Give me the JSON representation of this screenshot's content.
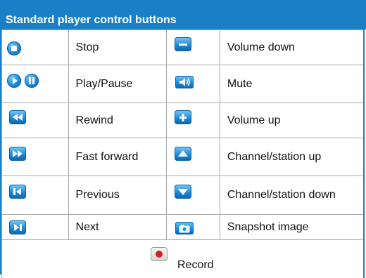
{
  "title": "Standard player control buttons",
  "rows": [
    {
      "left_icon": "stop-icon",
      "left_label": "Stop",
      "right_icon": "volume-down-icon",
      "right_label": "Volume down"
    },
    {
      "left_icon": "play-pause-icons",
      "left_label": "Play/Pause",
      "right_icon": "mute-icon",
      "right_label": "Mute"
    },
    {
      "left_icon": "rewind-icon",
      "left_label": "Rewind",
      "right_icon": "volume-up-icon",
      "right_label": "Volume up"
    },
    {
      "left_icon": "fast-forward-icon",
      "left_label": "Fast forward",
      "right_icon": "channel-up-icon",
      "right_label": "Channel/station up"
    },
    {
      "left_icon": "previous-icon",
      "left_label": "Previous",
      "right_icon": "channel-down-icon",
      "right_label": "Channel/station down"
    },
    {
      "left_icon": "next-icon",
      "left_label": "Next",
      "right_icon": "snapshot-icon",
      "right_label": "Snapshot image"
    }
  ],
  "record": {
    "icon": "record-icon",
    "label": "Record"
  },
  "colors": {
    "accent": "#1a7fc4",
    "record": "#d1221f"
  }
}
